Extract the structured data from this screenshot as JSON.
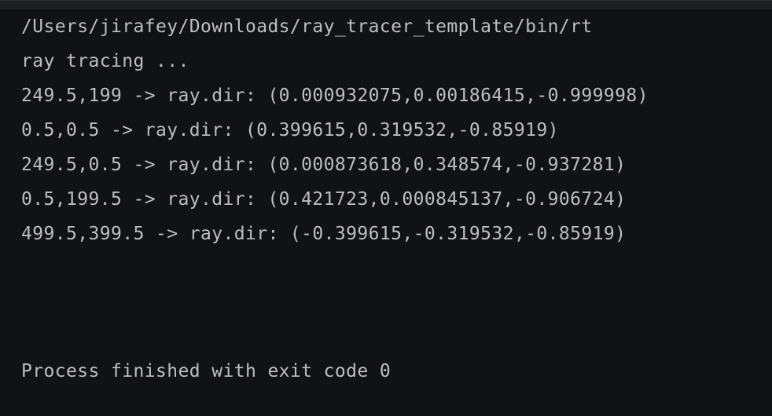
{
  "console": {
    "command_path": "/Users/jirafey/Downloads/ray_tracer_template/bin/rt",
    "output_lines": [
      "ray tracing ...",
      "249.5,199 -> ray.dir: (0.000932075,0.00186415,-0.999998)",
      "0.5,0.5 -> ray.dir: (0.399615,0.319532,-0.85919)",
      "249.5,0.5 -> ray.dir: (0.000873618,0.348574,-0.937281)",
      "0.5,199.5 -> ray.dir: (0.421723,0.000845137,-0.906724)",
      "499.5,399.5 -> ray.dir: (-0.399615,-0.319532,-0.85919)"
    ],
    "exit_message": "Process finished with exit code 0"
  },
  "colors": {
    "background": "#111214",
    "text": "#bcbec4"
  }
}
